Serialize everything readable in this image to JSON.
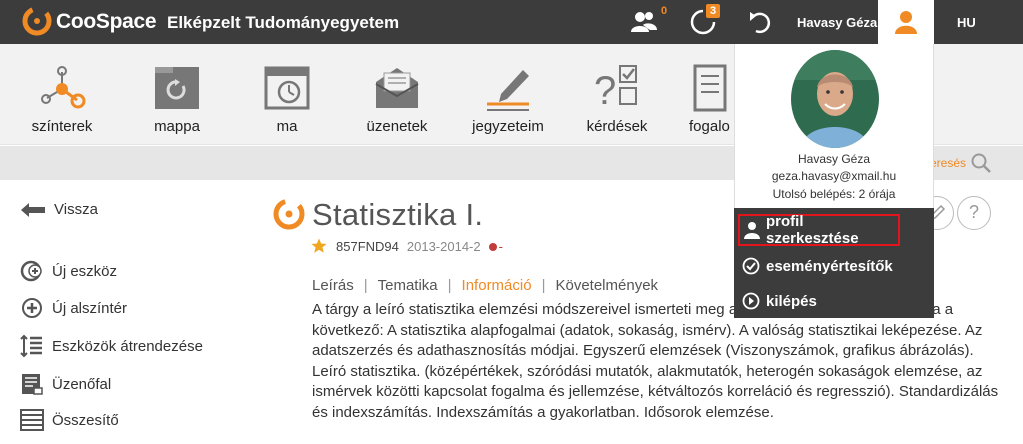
{
  "app": {
    "logo_text": "CooSpace",
    "org_name": "Elképzelt Tudományegyetem",
    "people_badge": "0",
    "notifications_badge": "3",
    "user_name": "Havasy Géza",
    "language": "HU"
  },
  "toolbar": {
    "items": [
      {
        "label": "színterek",
        "icon": "network-icon"
      },
      {
        "label": "mappa",
        "icon": "folder-icon"
      },
      {
        "label": "ma",
        "icon": "calendar-icon"
      },
      {
        "label": "üzenetek",
        "icon": "envelope-icon"
      },
      {
        "label": "jegyzeteim",
        "icon": "pencil-icon"
      },
      {
        "label": "kérdések",
        "icon": "quiz-icon"
      },
      {
        "label": "fogalo",
        "icon": "glossary-icon"
      }
    ],
    "search_fragment": "eresés"
  },
  "sidebar": {
    "back_label": "Vissza",
    "items": [
      {
        "label": "Új eszköz",
        "icon": "add-tool-icon"
      },
      {
        "label": "Új alszíntér",
        "icon": "add-subscene-icon"
      },
      {
        "label": "Eszközök átrendezése",
        "icon": "reorder-icon"
      },
      {
        "label": "Üzenőfal",
        "icon": "message-board-icon"
      },
      {
        "label": "Összesítő",
        "icon": "summary-icon"
      }
    ]
  },
  "course": {
    "title": "Statisztika I.",
    "code": "857FND94",
    "year": "2013-2014-2",
    "status_suffix": "-",
    "tabs": [
      "Leírás",
      "Tematika",
      "Információ",
      "Követelmények"
    ],
    "active_tab": "Információ",
    "separator": "|",
    "description": "A tárgy a leíró statisztika elemzési módszereivel ismerteti meg a hallgatókat. A tárgy tematikája a következő: A statisztika alapfogalmai (adatok, sokaság, ismérv). A valóság statisztikai leképezése. Az adatszerzés és adathasznosítás módjai. Egyszerű elemzések (Viszonyszámok, grafikus ábrázolás). Leíró statisztika. (középértékek, szóródási mutatók, alakmutatók, heterogén sokaságok elemzése, az ismérvek közötti kapcsolat fogalma és jellemzése, kétváltozós korreláció és regresszió). Standardizálás és indexszámítás. Indexszámítás a gyakorlatban. Idősorok elemzése.",
    "help_glyph": "?"
  },
  "user_menu": {
    "name": "Havasy Géza",
    "email": "geza.havasy@xmail.hu",
    "last_login": "Utolsó belépés: 2 órája",
    "items": [
      {
        "label": "profil szerkesztése",
        "icon": "user-icon"
      },
      {
        "label": "eseményértesítők",
        "icon": "check-circle-icon"
      },
      {
        "label": "kilépés",
        "icon": "logout-icon"
      }
    ]
  },
  "colors": {
    "brand": "#f08a24",
    "topbar": "#3c3c3c",
    "highlight_border": "#e2141c"
  }
}
